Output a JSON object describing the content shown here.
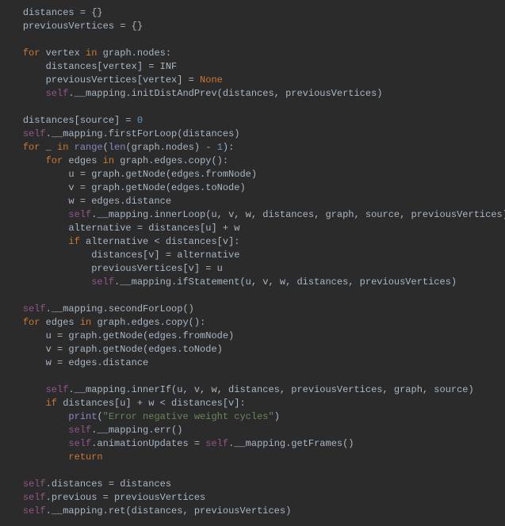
{
  "code": {
    "lines": [
      {
        "indent": 1,
        "tokens": [
          {
            "t": "distances = {}",
            "c": "p"
          }
        ]
      },
      {
        "indent": 1,
        "tokens": [
          {
            "t": "previousVertices = {}",
            "c": "p"
          }
        ]
      },
      {
        "indent": 1,
        "tokens": []
      },
      {
        "indent": 1,
        "tokens": [
          {
            "t": "for ",
            "c": "k"
          },
          {
            "t": "vertex ",
            "c": "p"
          },
          {
            "t": "in ",
            "c": "k"
          },
          {
            "t": "graph.nodes:",
            "c": "p"
          }
        ]
      },
      {
        "indent": 2,
        "tokens": [
          {
            "t": "distances[vertex] = INF",
            "c": "p"
          }
        ]
      },
      {
        "indent": 2,
        "tokens": [
          {
            "t": "previousVertices[vertex] = ",
            "c": "p"
          },
          {
            "t": "None",
            "c": "k"
          }
        ]
      },
      {
        "indent": 2,
        "tokens": [
          {
            "t": "self",
            "c": "s"
          },
          {
            "t": ".__mapping.initDistAndPrev(distances, previousVertices)",
            "c": "p"
          }
        ]
      },
      {
        "indent": 1,
        "tokens": []
      },
      {
        "indent": 1,
        "tokens": [
          {
            "t": "distances[source] = ",
            "c": "p"
          },
          {
            "t": "0",
            "c": "n"
          }
        ]
      },
      {
        "indent": 1,
        "tokens": [
          {
            "t": "self",
            "c": "s"
          },
          {
            "t": ".__mapping.firstForLoop(distances)",
            "c": "p"
          }
        ]
      },
      {
        "indent": 1,
        "tokens": [
          {
            "t": "for ",
            "c": "k"
          },
          {
            "t": "_ ",
            "c": "p"
          },
          {
            "t": "in ",
            "c": "k"
          },
          {
            "t": "range",
            "c": "bi"
          },
          {
            "t": "(",
            "c": "p"
          },
          {
            "t": "len",
            "c": "bi"
          },
          {
            "t": "(graph.nodes) - ",
            "c": "p"
          },
          {
            "t": "1",
            "c": "n"
          },
          {
            "t": "):",
            "c": "p"
          }
        ]
      },
      {
        "indent": 2,
        "tokens": [
          {
            "t": "for ",
            "c": "k"
          },
          {
            "t": "edges ",
            "c": "p"
          },
          {
            "t": "in ",
            "c": "k"
          },
          {
            "t": "graph.edges.copy():",
            "c": "p"
          }
        ]
      },
      {
        "indent": 3,
        "tokens": [
          {
            "t": "u = graph.getNode(edges.fromNode)",
            "c": "p"
          }
        ]
      },
      {
        "indent": 3,
        "tokens": [
          {
            "t": "v = graph.getNode(edges.toNode)",
            "c": "p"
          }
        ]
      },
      {
        "indent": 3,
        "tokens": [
          {
            "t": "w = edges.distance",
            "c": "p"
          }
        ]
      },
      {
        "indent": 3,
        "tokens": [
          {
            "t": "self",
            "c": "s"
          },
          {
            "t": ".__mapping.innerLoop(u, v, w, distances, graph, source, previousVertices)",
            "c": "p"
          }
        ]
      },
      {
        "indent": 3,
        "tokens": [
          {
            "t": "alternative = distances[u] + w",
            "c": "p"
          }
        ]
      },
      {
        "indent": 3,
        "tokens": [
          {
            "t": "if ",
            "c": "k"
          },
          {
            "t": "alternative < distances[v]:",
            "c": "p"
          }
        ]
      },
      {
        "indent": 4,
        "tokens": [
          {
            "t": "distances[v] = alternative",
            "c": "p"
          }
        ]
      },
      {
        "indent": 4,
        "tokens": [
          {
            "t": "previousVertices[v] = u",
            "c": "p"
          }
        ]
      },
      {
        "indent": 4,
        "tokens": [
          {
            "t": "self",
            "c": "s"
          },
          {
            "t": ".__mapping.ifStatement(u, v, w, distances, previousVertices)",
            "c": "p"
          }
        ]
      },
      {
        "indent": 1,
        "tokens": []
      },
      {
        "indent": 1,
        "tokens": [
          {
            "t": "self",
            "c": "s"
          },
          {
            "t": ".__mapping.secondForLoop()",
            "c": "p"
          }
        ]
      },
      {
        "indent": 1,
        "tokens": [
          {
            "t": "for ",
            "c": "k"
          },
          {
            "t": "edges ",
            "c": "p"
          },
          {
            "t": "in ",
            "c": "k"
          },
          {
            "t": "graph.edges.copy():",
            "c": "p"
          }
        ]
      },
      {
        "indent": 2,
        "tokens": [
          {
            "t": "u = graph.getNode(edges.fromNode)",
            "c": "p"
          }
        ]
      },
      {
        "indent": 2,
        "tokens": [
          {
            "t": "v = graph.getNode(edges.toNode)",
            "c": "p"
          }
        ]
      },
      {
        "indent": 2,
        "tokens": [
          {
            "t": "w = edges.distance",
            "c": "p"
          }
        ]
      },
      {
        "indent": 2,
        "tokens": []
      },
      {
        "indent": 2,
        "tokens": [
          {
            "t": "self",
            "c": "s"
          },
          {
            "t": ".__mapping.innerIf(u, v, w, distances, previousVertices, graph, source)",
            "c": "p"
          }
        ]
      },
      {
        "indent": 2,
        "tokens": [
          {
            "t": "if ",
            "c": "k"
          },
          {
            "t": "distances[u] + w < distances[v]:",
            "c": "p"
          }
        ]
      },
      {
        "indent": 3,
        "tokens": [
          {
            "t": "print",
            "c": "bi"
          },
          {
            "t": "(",
            "c": "p"
          },
          {
            "t": "\"Error negative weight cycles\"",
            "c": "str"
          },
          {
            "t": ")",
            "c": "p"
          }
        ]
      },
      {
        "indent": 3,
        "tokens": [
          {
            "t": "self",
            "c": "s"
          },
          {
            "t": ".__mapping.err()",
            "c": "p"
          }
        ]
      },
      {
        "indent": 3,
        "tokens": [
          {
            "t": "self",
            "c": "s"
          },
          {
            "t": ".animationUpdates = ",
            "c": "p"
          },
          {
            "t": "self",
            "c": "s"
          },
          {
            "t": ".__mapping.getFrames()",
            "c": "p"
          }
        ]
      },
      {
        "indent": 3,
        "tokens": [
          {
            "t": "return",
            "c": "k"
          }
        ]
      },
      {
        "indent": 1,
        "tokens": []
      },
      {
        "indent": 1,
        "tokens": [
          {
            "t": "self",
            "c": "s"
          },
          {
            "t": ".distances = distances",
            "c": "p"
          }
        ]
      },
      {
        "indent": 1,
        "tokens": [
          {
            "t": "self",
            "c": "s"
          },
          {
            "t": ".previous = previousVertices",
            "c": "p"
          }
        ]
      },
      {
        "indent": 1,
        "tokens": [
          {
            "t": "self",
            "c": "s"
          },
          {
            "t": ".__mapping.ret(distances, previousVertices)",
            "c": "p"
          }
        ]
      }
    ],
    "indentUnit": "    "
  }
}
